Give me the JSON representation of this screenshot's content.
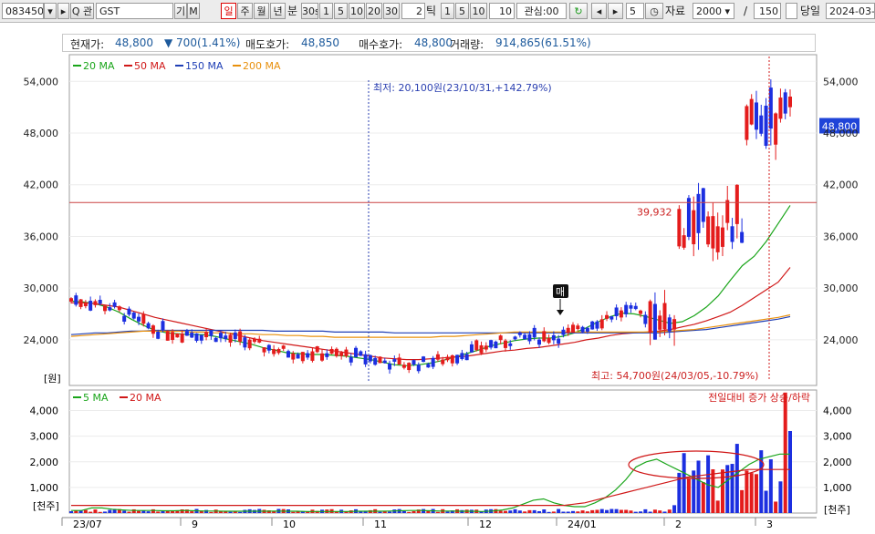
{
  "toolbar": {
    "code": "083450",
    "search_label": "Q 관",
    "name": "GST",
    "gi_label": "기",
    "m_label": "M",
    "periods": [
      "일",
      "주",
      "월",
      "년"
    ],
    "min_label": "분",
    "ticks": [
      "30s",
      "1",
      "5",
      "10",
      "20",
      "30"
    ],
    "tick_count": "2",
    "tick_label": "틱",
    "tick_options": [
      "1",
      "5",
      "10"
    ],
    "tick_value": "10",
    "watch_label": "관심:00",
    "step": "5",
    "data_label": "자료",
    "data_count": "2000",
    "slash": "/",
    "display_count": "150",
    "today_label": "당일",
    "date": "2024-03-0"
  },
  "info": {
    "current_label": "현재가:",
    "current": "48,800",
    "change": "▼ 700(1.41%)",
    "ask_label": "매도호가:",
    "ask": "48,850",
    "bid_label": "매수호가:",
    "bid": "48,800",
    "vol_label": "거래량:",
    "vol": "914,865(61.51%)"
  },
  "price_chart": {
    "legend": [
      {
        "label": "20 MA",
        "color": "#1aa51a"
      },
      {
        "label": "50 MA",
        "color": "#d01818"
      },
      {
        "label": "150 MA",
        "color": "#1f3fb5"
      },
      {
        "label": "200 MA",
        "color": "#e8900c"
      }
    ],
    "yticks": [
      "54,000",
      "48,000",
      "42,000",
      "36,000",
      "30,000",
      "24,000"
    ],
    "unit": "[원]",
    "current_tag": "48,800",
    "ref_value": "39,932",
    "low_annotation": "최저: 20,100원(23/10/31,+142.79%)",
    "high_annotation": "최고: 54,700원(24/03/05,-10.79%)",
    "signal_label": "매"
  },
  "volume_chart": {
    "legend": [
      {
        "label": "5 MA",
        "color": "#1aa51a"
      },
      {
        "label": "20 MA",
        "color": "#d01818"
      }
    ],
    "note": "전일대비 증가 상승/하락",
    "yticks": [
      "4,000",
      "3,000",
      "2,000",
      "1,000"
    ],
    "unit": "[천주]"
  },
  "x_labels": [
    "23/07",
    "9",
    "10",
    "11",
    "12",
    "24/01",
    "2",
    "3"
  ],
  "chart_data": {
    "type": "candlestick",
    "y_range": [
      18700,
      57100
    ],
    "ma_values": {
      "ma20": [
        28500,
        28400,
        28200,
        27800,
        27200,
        26400,
        25700,
        25100,
        24800,
        24700,
        24600,
        24600,
        24400,
        24100,
        23800,
        23500,
        23100,
        22800,
        22500,
        22400,
        22300,
        22300,
        22200,
        22100,
        21900,
        21700,
        21400,
        21100,
        21000,
        21100,
        21300,
        21600,
        22000,
        22400,
        22800,
        23300,
        23600,
        23900,
        24100,
        24200,
        24200,
        24400,
        24800,
        25400,
        26100,
        26700,
        27100,
        27000,
        26700,
        26300,
        25900,
        26100,
        26800,
        27800,
        29100,
        30900,
        32600,
        33700,
        35400,
        37500,
        39600
      ],
      "ma50": [
        28300,
        28300,
        28200,
        28000,
        27800,
        27400,
        27000,
        26600,
        26300,
        26000,
        25700,
        25400,
        25100,
        24800,
        24500,
        24200,
        23900,
        23700,
        23500,
        23300,
        23100,
        22900,
        22700,
        22500,
        22300,
        22100,
        21900,
        21800,
        21700,
        21700,
        21800,
        21900,
        22000,
        22100,
        22300,
        22500,
        22700,
        22800,
        23000,
        23100,
        23300,
        23500,
        23700,
        24000,
        24200,
        24500,
        24700,
        24800,
        24900,
        25000,
        25200,
        25500,
        25800,
        26200,
        26700,
        27200,
        28000,
        28900,
        29800,
        30700,
        32400
      ],
      "ma150": [
        24600,
        24700,
        24800,
        24800,
        24900,
        25000,
        25000,
        25100,
        25100,
        25100,
        25100,
        25100,
        25100,
        25100,
        25100,
        25100,
        25100,
        25000,
        25000,
        25000,
        25000,
        25000,
        24900,
        24900,
        24900,
        24900,
        24900,
        24800,
        24800,
        24800,
        24800,
        24800,
        24800,
        24800,
        24800,
        24800,
        24800,
        24800,
        24800,
        24800,
        24800,
        24800,
        24800,
        24800,
        24800,
        24800,
        24800,
        24800,
        24800,
        24800,
        24900,
        25000,
        25100,
        25200,
        25400,
        25600,
        25800,
        26000,
        26200,
        26400,
        26700
      ],
      "ma200": [
        24400,
        24500,
        24600,
        24700,
        24800,
        24900,
        25000,
        25000,
        25000,
        25000,
        24900,
        24900,
        24800,
        24800,
        24700,
        24700,
        24600,
        24600,
        24500,
        24500,
        24400,
        24400,
        24300,
        24300,
        24300,
        24300,
        24300,
        24300,
        24300,
        24300,
        24300,
        24400,
        24400,
        24500,
        24600,
        24700,
        24800,
        24900,
        24900,
        24900,
        24900,
        24900,
        24900,
        24900,
        24900,
        24900,
        24900,
        24900,
        24900,
        24900,
        25000,
        25100,
        25200,
        25400,
        25600,
        25800,
        26000,
        26200,
        26400,
        26600,
        26900
      ]
    },
    "volume_y_range": [
      0,
      4800
    ],
    "volume_ma": {
      "ma5": [
        100,
        100,
        200,
        200,
        150,
        120,
        100,
        100,
        100,
        90,
        90,
        100,
        90,
        80,
        80,
        70,
        70,
        70,
        70,
        70,
        80,
        70,
        70,
        60,
        60,
        60,
        60,
        60,
        70,
        70,
        70,
        80,
        90,
        100,
        100,
        90,
        80,
        80,
        70,
        70,
        60,
        80,
        120,
        200,
        350,
        500,
        550,
        400,
        300,
        250,
        250,
        400,
        600,
        900,
        1300,
        1800,
        2000,
        2100,
        1900,
        1700,
        1500,
        1300,
        1100,
        1000,
        1300,
        1600,
        1900,
        2100,
        2200,
        2300,
        2300
      ],
      "ma20": [
        300,
        300,
        300,
        300,
        300,
        300,
        300,
        300,
        300,
        300,
        300,
        300,
        300,
        300,
        300,
        300,
        300,
        300,
        300,
        300,
        300,
        300,
        300,
        300,
        300,
        300,
        300,
        300,
        300,
        300,
        300,
        300,
        300,
        300,
        300,
        300,
        300,
        300,
        300,
        300,
        300,
        300,
        300,
        300,
        300,
        300,
        300,
        300,
        300,
        350,
        400,
        500,
        600,
        700,
        800,
        900,
        1000,
        1100,
        1200,
        1300,
        1400,
        1450,
        1500,
        1550,
        1600,
        1650,
        1700,
        1700,
        1700,
        1700,
        1700
      ]
    },
    "volume_note": "전일대비 증가 상승/하락"
  }
}
